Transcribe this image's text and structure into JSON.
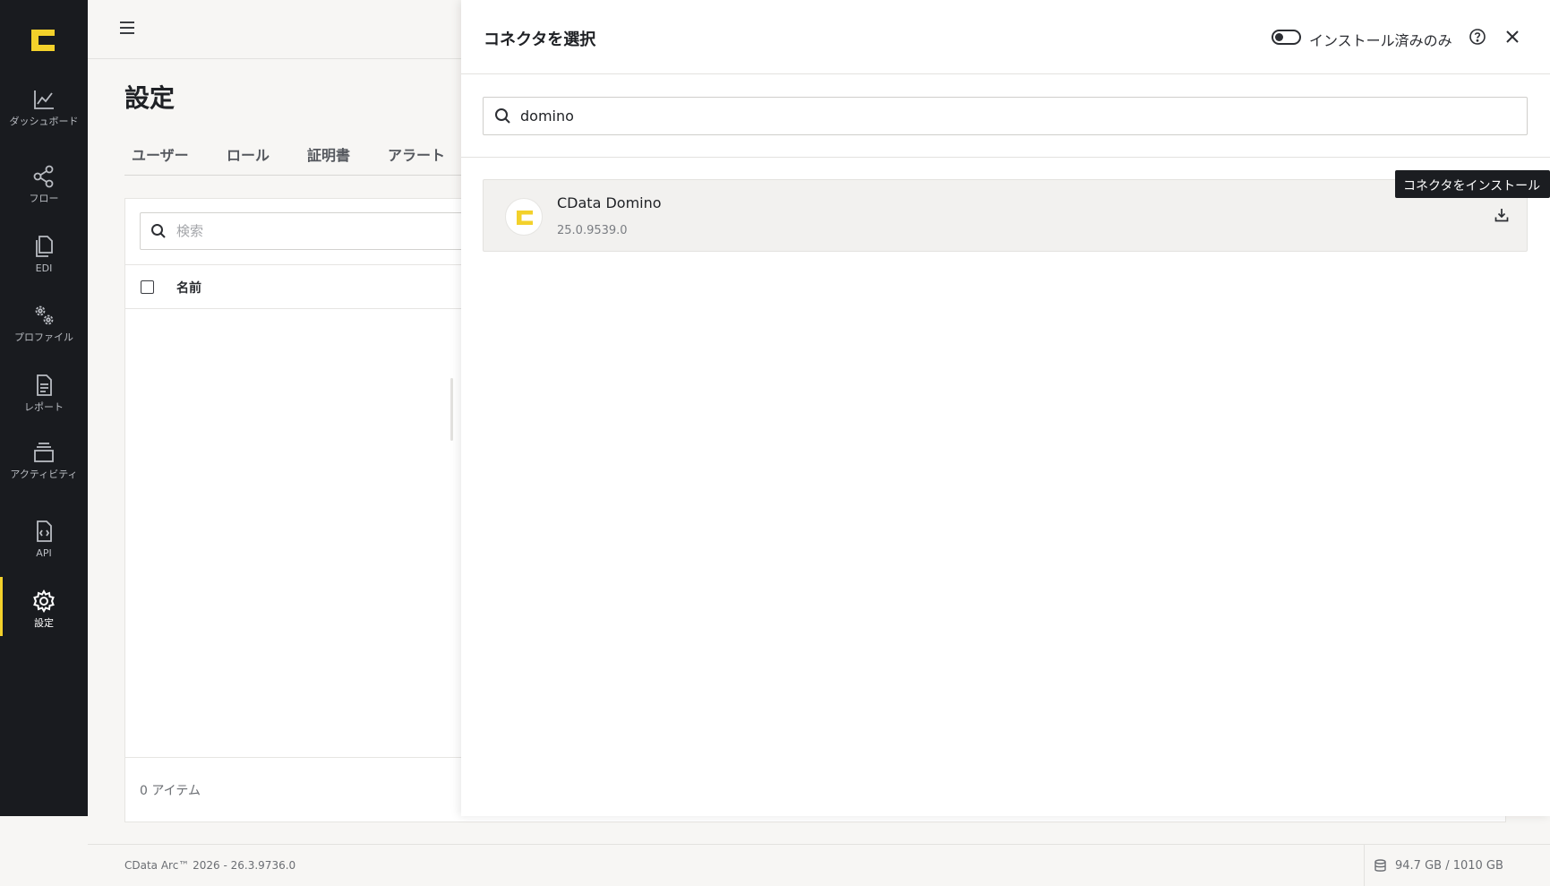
{
  "app": {
    "accent_color": "#f3d12b",
    "sidebar_color": "#191b1f"
  },
  "sidebar": {
    "logo_icon": "cdata-logo-icon",
    "items": [
      {
        "label": "ダッシュボード",
        "icon": "chart-line-icon",
        "active": false
      },
      {
        "label": "フロー",
        "icon": "share-nodes-icon",
        "active": false
      },
      {
        "label": "EDI",
        "icon": "documents-icon",
        "active": false
      },
      {
        "label": "プロファイル",
        "icon": "gears-icon",
        "active": false
      },
      {
        "label": "レポート",
        "icon": "report-icon",
        "active": false
      },
      {
        "label": "アクティビティ",
        "icon": "activity-stack-icon",
        "active": false
      },
      {
        "label": "API",
        "icon": "api-file-icon",
        "active": false
      },
      {
        "label": "設定",
        "icon": "gear-icon",
        "active": true
      }
    ]
  },
  "settings": {
    "title": "設定",
    "tabs": [
      "ユーザー",
      "ロール",
      "証明書",
      "アラート"
    ],
    "search_placeholder": "検索",
    "column_name": "名前",
    "item_count": "0 アイテム"
  },
  "drawer": {
    "title": "コネクタを選択",
    "installed_only_label": "インストール済みのみ",
    "installed_only_on": false,
    "search_value": "domino",
    "connectors": [
      {
        "name": "CData Domino",
        "version": "25.0.9539.0",
        "installed": false
      }
    ],
    "install_tooltip": "コネクタをインストール"
  },
  "statusbar": {
    "version": "CData Arc™ 2026 - 26.3.9736.0",
    "storage": "94.7 GB / 1010 GB"
  }
}
